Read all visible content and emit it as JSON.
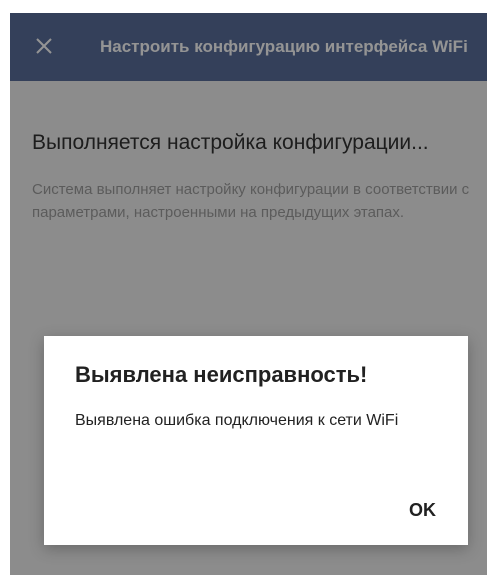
{
  "app_bar": {
    "title": "Настроить конфигурацию интерфейса WiFi",
    "close_icon": "close-icon",
    "color": "#5b6f9b"
  },
  "content": {
    "heading": "Выполняется настройка конфигурации...",
    "description": "Система выполняет настройку конфигурации в соответствии с параметрами, настроенными на предыдущих этапах."
  },
  "dialog": {
    "title": "Выявлена неисправность!",
    "message": "Выявлена ошибка подключения к сети WiFi",
    "ok_label": "OK"
  }
}
